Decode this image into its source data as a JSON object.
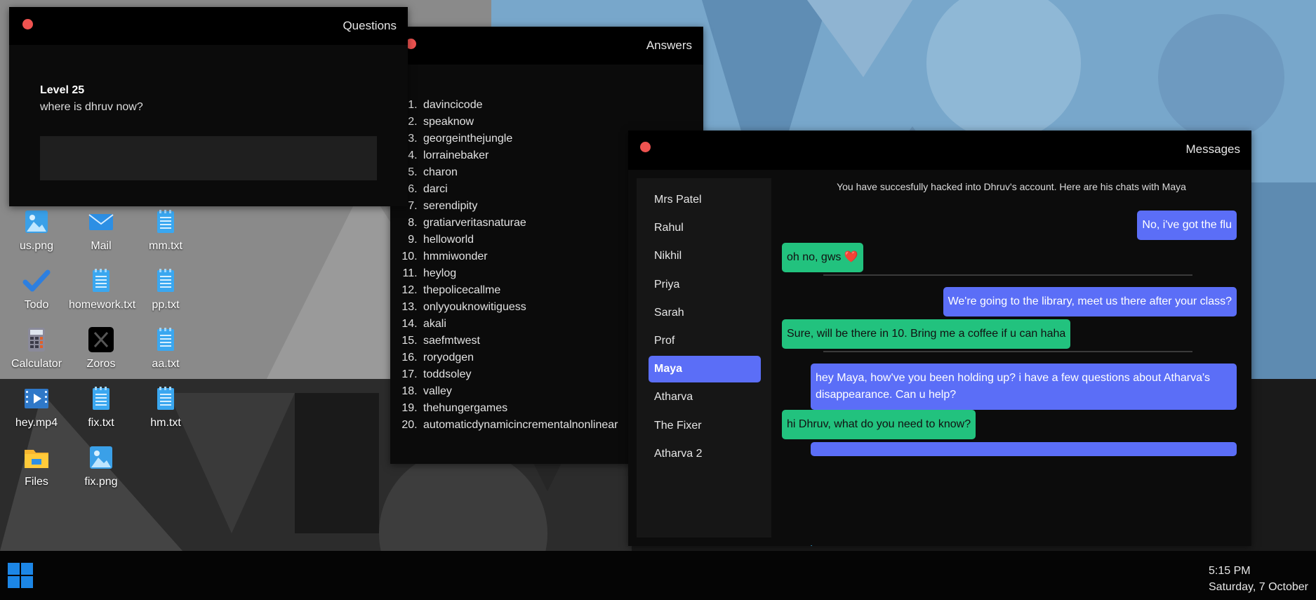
{
  "questions_window": {
    "title": "Questions",
    "level": "Level 25",
    "question": "where is dhruv now?",
    "answer_value": ""
  },
  "answers_window": {
    "title": "Answers",
    "items": [
      "davincicode",
      "speaknow",
      "georgeinthejungle",
      "lorrainebaker",
      "charon",
      "darci",
      "serendipity",
      "gratiarveritasnaturae",
      "helloworld",
      "hmmiwonder",
      "heylog",
      "thepolicecallme",
      "onlyyouknowitiguess",
      "akali",
      "saefmtwest",
      "roryodgen",
      "toddsoley",
      "valley",
      "thehungergames",
      "automaticdynamicincrementalnonlinear"
    ]
  },
  "messages_window": {
    "title": "Messages",
    "contacts": [
      "Mrs Patel",
      "Rahul",
      "Nikhil",
      "Priya",
      "Sarah",
      "Prof",
      "Maya",
      "Atharva",
      "The Fixer",
      "Atharva 2"
    ],
    "active_contact": "Maya",
    "notice": "You have succesfully hacked into Dhruv's account. Here are his chats with Maya",
    "messages": [
      {
        "from": "sent",
        "text": "No, i've got the flu"
      },
      {
        "from": "recv",
        "text": "oh no, gws ❤️"
      },
      {
        "from": "sent",
        "text": "We're going to the library, meet us there after your class?"
      },
      {
        "from": "recv",
        "text": "Sure, will be there in 10. Bring me a coffee if u can haha"
      },
      {
        "from": "sent",
        "text": "hey Maya, how've you been holding up? i have a few questions about Atharva's disappearance. Can u help?"
      },
      {
        "from": "recv",
        "text": "hi Dhruv, what do you need to know?"
      }
    ],
    "compose_value": ""
  },
  "desktop_icons": [
    {
      "label": "us.png",
      "icon": "image-icon"
    },
    {
      "label": "Mail",
      "icon": "mail-icon"
    },
    {
      "label": "mm.txt",
      "icon": "text-file-icon"
    },
    {
      "label": "Todo",
      "icon": "checkmark-icon"
    },
    {
      "label": "homework.txt",
      "icon": "text-file-icon"
    },
    {
      "label": "pp.txt",
      "icon": "text-file-icon"
    },
    {
      "label": "Calculator",
      "icon": "calculator-icon"
    },
    {
      "label": "Zoros",
      "icon": "x-logo-icon"
    },
    {
      "label": "aa.txt",
      "icon": "text-file-icon"
    },
    {
      "label": "hey.mp4",
      "icon": "video-file-icon"
    },
    {
      "label": "fix.txt",
      "icon": "text-file-icon"
    },
    {
      "label": "hm.txt",
      "icon": "text-file-icon"
    },
    {
      "label": "Files",
      "icon": "folder-icon"
    },
    {
      "label": "fix.png",
      "icon": "image-icon"
    }
  ],
  "taskbar": {
    "time": "5:15 PM",
    "date": "Saturday, 7 October"
  },
  "colors": {
    "accent": "#5b6ef7",
    "received": "#22c27e",
    "close": "#ef5350",
    "start": "#1c86e6"
  }
}
